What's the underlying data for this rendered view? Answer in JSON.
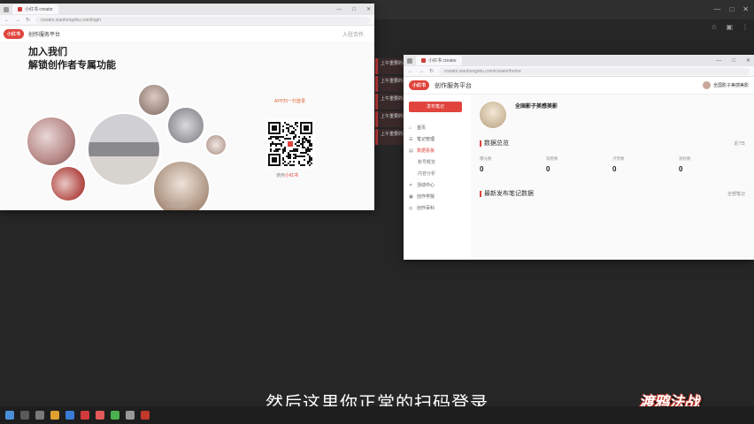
{
  "colors": {
    "accent": "#e0443c",
    "desktop": "#262626"
  },
  "desktop": {
    "left_tabs": [
      "上午重要的事",
      "上午重要的事",
      "上午重要的事",
      "上午重要的事",
      "上午重要的事"
    ]
  },
  "window1": {
    "tab_title": "小红书 creator",
    "url": "creator.xiaohongshu.com/login",
    "logo": "小红书",
    "platform_name": "创作服务平台",
    "top_right_link": "入驻合作",
    "hero_line1": "加入我们",
    "hero_line2": "解锁创作者专属功能",
    "qr_label": "APP扫一扫登录",
    "qr_hint_prefix": "使用",
    "qr_hint_app": "小红书",
    "footer": "© 2014-2024"
  },
  "window2": {
    "tab_title": "小红书 creator",
    "url": "creator.xiaohongshu.com/creator/home",
    "logo": "小红书",
    "platform_name": "创作服务平台",
    "username": "全国影子美感美影",
    "publish_button": "发布笔记",
    "sidebar": [
      {
        "label": "首页",
        "icon": "home-icon",
        "sub": false,
        "active": false
      },
      {
        "label": "笔记管理",
        "icon": "note-icon",
        "sub": false,
        "active": false
      },
      {
        "label": "数据看板",
        "icon": "chart-icon",
        "sub": false,
        "active": true
      },
      {
        "label": "账号概览",
        "icon": "",
        "sub": true,
        "active": false
      },
      {
        "label": "内容分析",
        "icon": "",
        "sub": true,
        "active": false
      },
      {
        "label": "活动中心",
        "icon": "gift-icon",
        "sub": false,
        "active": false
      },
      {
        "label": "创作学院",
        "icon": "book-icon",
        "sub": false,
        "active": false
      },
      {
        "label": "创作百科",
        "icon": "wiki-icon",
        "sub": false,
        "active": false
      }
    ],
    "profile_name": "全国影子美感美影",
    "section_data": "数据总览",
    "section_data_more": "近7日",
    "stats": [
      {
        "label": "曝光数",
        "value": "0"
      },
      {
        "label": "观看数",
        "value": "0"
      },
      {
        "label": "点赞数",
        "value": "0"
      },
      {
        "label": "涨粉数",
        "value": "0"
      }
    ],
    "section_recent": "最新发布笔记数据",
    "section_recent_more": "全部笔记"
  },
  "subtitle": "然后这里你正常的扫码登录",
  "watermark": "渡鸦法战"
}
